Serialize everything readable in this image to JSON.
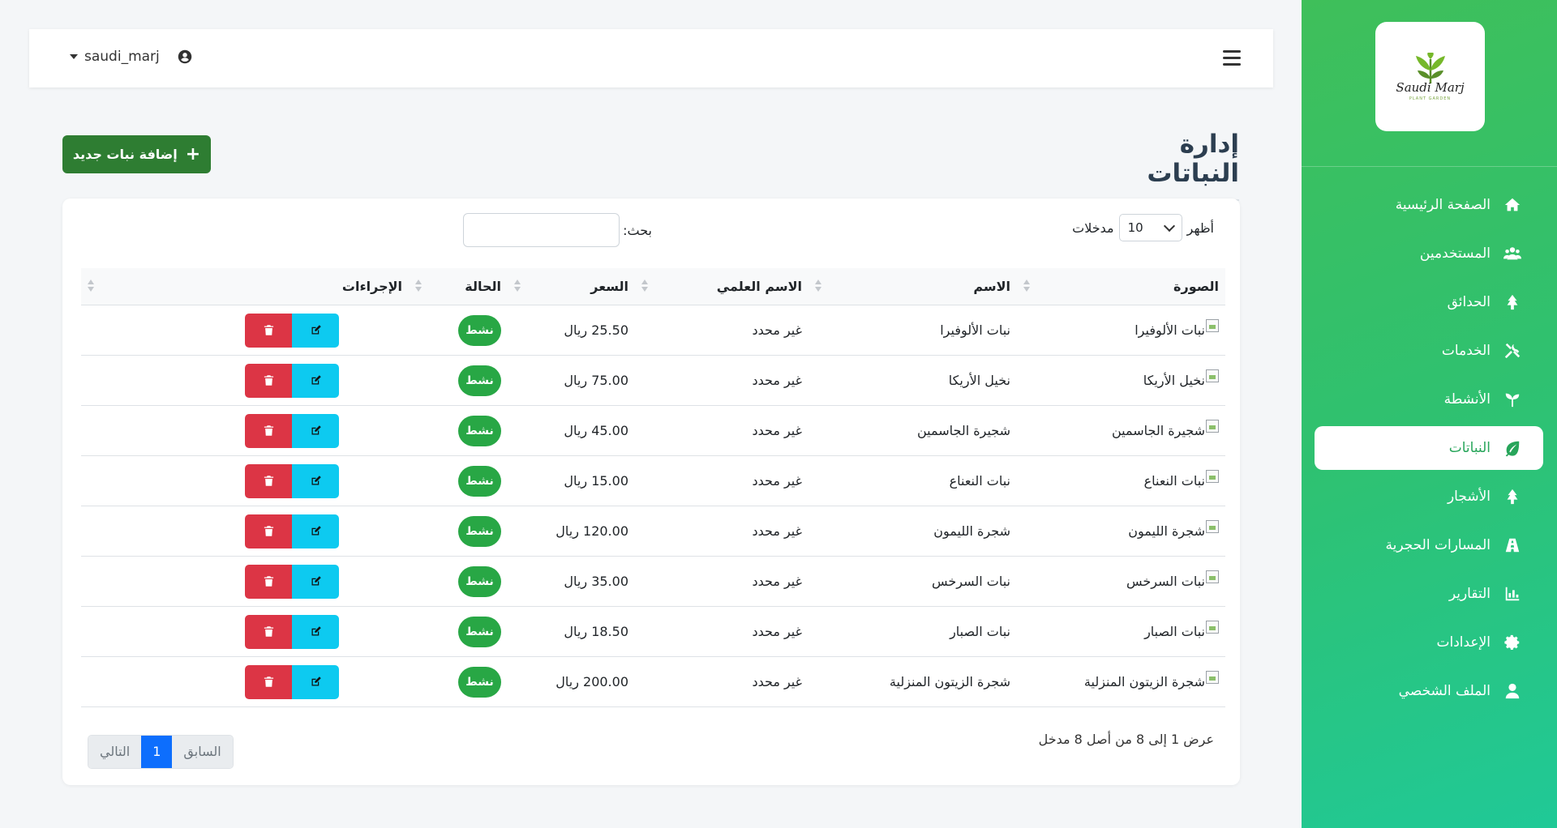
{
  "sidebar": {
    "logo": {
      "title": "Saudi Marj",
      "subtitle": "PLANT GARDEN"
    },
    "items": [
      {
        "label": "الصفحة الرئيسية",
        "icon": "home-icon"
      },
      {
        "label": "المستخدمين",
        "icon": "users-icon"
      },
      {
        "label": "الحدائق",
        "icon": "tree-icon"
      },
      {
        "label": "الخدمات",
        "icon": "tools-icon"
      },
      {
        "label": "الأنشطة",
        "icon": "seedling-icon"
      },
      {
        "label": "النباتات",
        "icon": "leaf-icon",
        "active": true
      },
      {
        "label": "الأشجار",
        "icon": "tree-icon"
      },
      {
        "label": "المسارات الحجرية",
        "icon": "road-icon"
      },
      {
        "label": "التقارير",
        "icon": "chart-icon"
      },
      {
        "label": "الإعدادات",
        "icon": "gear-icon"
      },
      {
        "label": "الملف الشخصي",
        "icon": "user-icon"
      }
    ]
  },
  "topbar": {
    "username": "saudi_marj"
  },
  "page": {
    "title": "إدارة النباتات",
    "add_button": "إضافة نبات جديد"
  },
  "table_controls": {
    "show_label": "أظهر",
    "entries_label": "مدخلات",
    "page_length": "10",
    "search_label": "بحث:"
  },
  "table": {
    "headers": [
      "الصورة",
      "الاسم",
      "الاسم العلمي",
      "السعر",
      "الحالة",
      "الإجراءات"
    ],
    "rows": [
      {
        "image_alt": "نبات الألوفيرا",
        "name": "نبات الألوفيرا",
        "scientific": "غير محدد",
        "price": "25.50 ريال",
        "status": "نشط"
      },
      {
        "image_alt": "نخيل الأريكا",
        "name": "نخيل الأريكا",
        "scientific": "غير محدد",
        "price": "75.00 ريال",
        "status": "نشط"
      },
      {
        "image_alt": "شجيرة الجاسمين",
        "name": "شجيرة الجاسمين",
        "scientific": "غير محدد",
        "price": "45.00 ريال",
        "status": "نشط"
      },
      {
        "image_alt": "نبات النعناع",
        "name": "نبات النعناع",
        "scientific": "غير محدد",
        "price": "15.00 ريال",
        "status": "نشط"
      },
      {
        "image_alt": "شجرة الليمون",
        "name": "شجرة الليمون",
        "scientific": "غير محدد",
        "price": "120.00 ريال",
        "status": "نشط"
      },
      {
        "image_alt": "نبات السرخس",
        "name": "نبات السرخس",
        "scientific": "غير محدد",
        "price": "35.00 ريال",
        "status": "نشط"
      },
      {
        "image_alt": "نبات الصبار",
        "name": "نبات الصبار",
        "scientific": "غير محدد",
        "price": "18.50 ريال",
        "status": "نشط"
      },
      {
        "image_alt": "شجرة الزيتون المنزلية",
        "name": "شجرة الزيتون المنزلية",
        "scientific": "غير محدد",
        "price": "200.00 ريال",
        "status": "نشط"
      }
    ]
  },
  "footer": {
    "info": "عرض 1 إلى 8 من أصل 8 مدخل",
    "prev": "السابق",
    "current_page": "1",
    "next": "التالي"
  },
  "colors": {
    "sidebar_start": "#3fbf5a",
    "sidebar_end": "#20c997",
    "primary_green": "#2e7d32",
    "badge_green": "#28a745",
    "delete_red": "#dc3545",
    "edit_cyan": "#0dcaf0",
    "page_blue": "#0d6efd"
  }
}
